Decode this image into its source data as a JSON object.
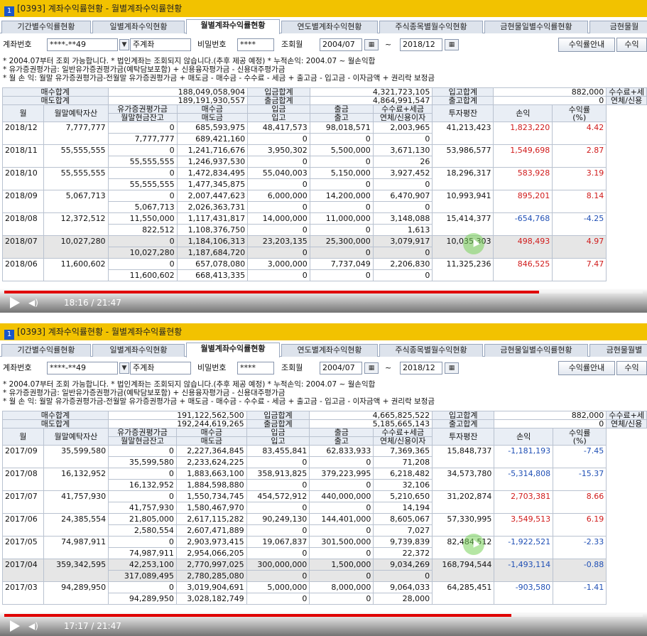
{
  "panels": [
    {
      "window_number": "1",
      "title": "[0393] 계좌수익률현황 - 월별계좌수익률현황",
      "tabs": [
        "기간별수익률현황",
        "일별계좌수익현황",
        "월별계좌수익률현황",
        "연도별계좌수익현황",
        "주식종목별월수익현황",
        "금현물일별수익률현황",
        "금현물월"
      ],
      "active_tab": 2,
      "account_label": "계좌번호",
      "account_value": "****-**49",
      "account_type": "주계좌",
      "password_label": "비밀번호",
      "password_value": "****",
      "period_label": "조회월",
      "from_month": "2004/07",
      "tilde": "~",
      "to_month": "2018/12",
      "btn_guide": "수익률안내",
      "btn_more": "수익",
      "notes": [
        "* 2004.07부터 조회 가능합니다.   * 법인계좌는 조회되지 않습니다.(추후 제공 예정)   * 누적손익: 2004.07 ~ 월손익합",
        "* 유가증권평가금: 일반유가증권평가금(예탁담보포함) + 신용융자평가금 - 신용대주평가금",
        "* 월 손 익: 월말 유가증권평가금-전월말 유가증권평가금 + 매도금 - 매수금 - 수수료 - 세금 + 출고금 - 입고금 - 이자금액 + 권리락 보정금"
      ],
      "summary": {
        "buy_total_label": "매수합계",
        "buy_total": "188,049,058,904",
        "deposit_total_label": "입금합계",
        "deposit_total": "4,321,723,105",
        "in_total_label": "입고합계",
        "in_total": "882,000",
        "fee_tax_label": "수수료+세",
        "sell_total_label": "매도합계",
        "sell_total": "189,191,930,557",
        "withdraw_total_label": "출금합계",
        "withdraw_total": "4,864,991,547",
        "out_total_label": "출고합계",
        "out_total": "0",
        "overdue_label": "연체/신용"
      },
      "headers": {
        "month": "월",
        "end_deposit": "월말예탁자산",
        "sec_eval": "유가증권평가금",
        "end_cash": "월말현금잔고",
        "buy": "매수금",
        "sell": "매도금",
        "deposit": "입금",
        "in": "입고",
        "withdraw": "출금",
        "out": "출고",
        "fee_tax": "수수료+세금",
        "overdue_int": "연체/신용이자",
        "avg_invest": "투자평잔",
        "pl": "손익",
        "rate": "수익률",
        "rate_unit": "(%)"
      },
      "rows": [
        {
          "month": "2018/12",
          "end_deposit": "7,777,777",
          "sec_eval": "0",
          "end_cash": "7,777,777",
          "buy": "685,593,975",
          "sell": "689,421,160",
          "deposit": "48,417,573",
          "in": "0",
          "withdraw": "98,018,571",
          "out": "0",
          "fee_tax": "2,003,965",
          "overdue_int": "0",
          "avg_invest": "41,213,423",
          "pl": "1,823,220",
          "rate": "4.42",
          "sign": "pos"
        },
        {
          "month": "2018/11",
          "end_deposit": "55,555,555",
          "sec_eval": "0",
          "end_cash": "55,555,555",
          "buy": "1,241,716,676",
          "sell": "1,246,937,530",
          "deposit": "3,950,302",
          "in": "0",
          "withdraw": "5,500,000",
          "out": "0",
          "fee_tax": "3,671,130",
          "overdue_int": "26",
          "avg_invest": "53,986,577",
          "pl": "1,549,698",
          "rate": "2.87",
          "sign": "pos"
        },
        {
          "month": "2018/10",
          "end_deposit": "55,555,555",
          "sec_eval": "0",
          "end_cash": "55,555,555",
          "buy": "1,472,834,495",
          "sell": "1,477,345,875",
          "deposit": "55,040,003",
          "in": "0",
          "withdraw": "5,150,000",
          "out": "0",
          "fee_tax": "3,927,452",
          "overdue_int": "0",
          "avg_invest": "18,296,317",
          "pl": "583,928",
          "rate": "3.19",
          "sign": "pos"
        },
        {
          "month": "2018/09",
          "end_deposit": "5,067,713",
          "sec_eval": "0",
          "end_cash": "5,067,713",
          "buy": "2,007,447,623",
          "sell": "2,026,363,731",
          "deposit": "6,000,000",
          "in": "0",
          "withdraw": "14,200,000",
          "out": "0",
          "fee_tax": "6,470,907",
          "overdue_int": "0",
          "avg_invest": "10,993,941",
          "pl": "895,201",
          "rate": "8.14",
          "sign": "pos"
        },
        {
          "month": "2018/08",
          "end_deposit": "12,372,512",
          "sec_eval": "11,550,000",
          "end_cash": "822,512",
          "buy": "1,117,431,817",
          "sell": "1,108,376,750",
          "deposit": "14,000,000",
          "in": "0",
          "withdraw": "11,000,000",
          "out": "0",
          "fee_tax": "3,148,088",
          "overdue_int": "1,613",
          "avg_invest": "15,414,377",
          "pl": "-654,768",
          "rate": "-4.25",
          "sign": "neg"
        },
        {
          "month": "2018/07",
          "end_deposit": "10,027,280",
          "sec_eval": "0",
          "end_cash": "10,027,280",
          "buy": "1,184,106,313",
          "sell": "1,187,684,720",
          "deposit": "23,203,135",
          "in": "0",
          "withdraw": "25,300,000",
          "out": "0",
          "fee_tax": "3,079,917",
          "overdue_int": "0",
          "avg_invest": "10,035,303",
          "pl": "498,493",
          "rate": "4.97",
          "sign": "pos"
        },
        {
          "month": "2018/06",
          "end_deposit": "11,600,602",
          "sec_eval": "0",
          "end_cash": "11,600,602",
          "buy": "657,078,080",
          "sell": "668,413,335",
          "deposit": "3,000,000",
          "in": "0",
          "withdraw": "7,737,049",
          "out": "0",
          "fee_tax": "2,206,830",
          "overdue_int": "0",
          "avg_invest": "11,325,236",
          "pl": "846,525",
          "rate": "7.47",
          "sign": "pos"
        }
      ],
      "highlight_row": 5,
      "cursor_row": 5,
      "video": {
        "time": "18:16 / 21:47",
        "progress": 0.838
      }
    },
    {
      "window_number": "1",
      "title": "[0393] 계좌수익률현황 - 월별계좌수익률현황",
      "tabs": [
        "기간별수익률현황",
        "일별계좌수익현황",
        "월별계좌수익률현황",
        "연도별계좌수익현황",
        "주식종목별월수익현황",
        "금현물일별수익률현황",
        "금현물월별"
      ],
      "active_tab": 2,
      "account_label": "계좌번호",
      "account_value": "****-**49",
      "account_type": "주계좌",
      "password_label": "비밀번호",
      "password_value": "****",
      "period_label": "조회월",
      "from_month": "2004/07",
      "tilde": "~",
      "to_month": "2018/12",
      "btn_guide": "수익률안내",
      "btn_more": "수익",
      "notes": [
        "* 2004.07부터 조회 가능합니다.   * 법인계좌는 조회되지 않습니다.(추후 제공 예정)   * 누적손익: 2004.07 ~ 월손익합",
        "* 유가증권평가금: 일반유가증권평가금(예탁담보포함) + 신용융자평가금 - 신용대주평가금",
        "* 월 손 익: 월말 유가증권평가금-전월말 유가증권평가금 + 매도금 - 매수금 - 수수료 - 세금 + 출고금 - 입고금 - 이자금액 + 권리락 보정금"
      ],
      "summary": {
        "buy_total_label": "매수합계",
        "buy_total": "191,122,562,500",
        "deposit_total_label": "입금합계",
        "deposit_total": "4,665,825,522",
        "in_total_label": "입고합계",
        "in_total": "882,000",
        "fee_tax_label": "수수료+세",
        "sell_total_label": "매도합계",
        "sell_total": "192,244,619,265",
        "withdraw_total_label": "출금합계",
        "withdraw_total": "5,185,665,143",
        "out_total_label": "출고합계",
        "out_total": "0",
        "overdue_label": "연체/신용"
      },
      "headers": {
        "month": "월",
        "end_deposit": "월말예탁자산",
        "sec_eval": "유가증권평가금",
        "end_cash": "월말현금잔고",
        "buy": "매수금",
        "sell": "매도금",
        "deposit": "입금",
        "in": "입고",
        "withdraw": "출금",
        "out": "출고",
        "fee_tax": "수수료+세금",
        "overdue_int": "연체/신용이자",
        "avg_invest": "투자평잔",
        "pl": "손익",
        "rate": "수익률",
        "rate_unit": "(%)"
      },
      "rows": [
        {
          "month": "2017/09",
          "end_deposit": "35,599,580",
          "sec_eval": "0",
          "end_cash": "35,599,580",
          "buy": "2,227,364,845",
          "sell": "2,233,624,225",
          "deposit": "83,455,841",
          "in": "0",
          "withdraw": "62,833,933",
          "out": "0",
          "fee_tax": "7,369,365",
          "overdue_int": "71,208",
          "avg_invest": "15,848,737",
          "pl": "-1,181,193",
          "rate": "-7.45",
          "sign": "neg"
        },
        {
          "month": "2017/08",
          "end_deposit": "16,132,952",
          "sec_eval": "0",
          "end_cash": "16,132,952",
          "buy": "1,883,663,100",
          "sell": "1,884,598,880",
          "deposit": "358,913,825",
          "in": "0",
          "withdraw": "379,223,995",
          "out": "0",
          "fee_tax": "6,218,482",
          "overdue_int": "32,106",
          "avg_invest": "34,573,780",
          "pl": "-5,314,808",
          "rate": "-15.37",
          "sign": "neg"
        },
        {
          "month": "2017/07",
          "end_deposit": "41,757,930",
          "sec_eval": "0",
          "end_cash": "41,757,930",
          "buy": "1,550,734,745",
          "sell": "1,580,467,970",
          "deposit": "454,572,912",
          "in": "0",
          "withdraw": "440,000,000",
          "out": "0",
          "fee_tax": "5,210,650",
          "overdue_int": "14,194",
          "avg_invest": "31,202,874",
          "pl": "2,703,381",
          "rate": "8.66",
          "sign": "pos"
        },
        {
          "month": "2017/06",
          "end_deposit": "24,385,554",
          "sec_eval": "21,805,000",
          "end_cash": "2,580,554",
          "buy": "2,617,115,282",
          "sell": "2,607,471,889",
          "deposit": "90,249,130",
          "in": "0",
          "withdraw": "144,401,000",
          "out": "0",
          "fee_tax": "8,605,067",
          "overdue_int": "7,027",
          "avg_invest": "57,330,995",
          "pl": "3,549,513",
          "rate": "6.19",
          "sign": "pos"
        },
        {
          "month": "2017/05",
          "end_deposit": "74,987,911",
          "sec_eval": "0",
          "end_cash": "74,987,911",
          "buy": "2,903,973,415",
          "sell": "2,954,066,205",
          "deposit": "19,067,837",
          "in": "0",
          "withdraw": "301,500,000",
          "out": "0",
          "fee_tax": "9,739,839",
          "overdue_int": "22,372",
          "avg_invest": "82,484,512",
          "pl": "-1,922,521",
          "rate": "-2.33",
          "sign": "neg"
        },
        {
          "month": "2017/04",
          "end_deposit": "359,342,595",
          "sec_eval": "42,253,100",
          "end_cash": "317,089,495",
          "buy": "2,770,997,025",
          "sell": "2,780,285,080",
          "deposit": "300,000,000",
          "in": "0",
          "withdraw": "1,500,000",
          "out": "0",
          "fee_tax": "9,034,269",
          "overdue_int": "0",
          "avg_invest": "168,794,544",
          "pl": "-1,493,114",
          "rate": "-0.88",
          "sign": "neg"
        },
        {
          "month": "2017/03",
          "end_deposit": "94,289,950",
          "sec_eval": "0",
          "end_cash": "94,289,950",
          "buy": "3,019,904,691",
          "sell": "3,028,182,749",
          "deposit": "5,000,000",
          "in": "0",
          "withdraw": "8,000,000",
          "out": "0",
          "fee_tax": "9,064,033",
          "overdue_int": "28,000",
          "avg_invest": "64,285,451",
          "pl": "-903,580",
          "rate": "-1.41",
          "sign": "neg"
        }
      ],
      "highlight_row": 5,
      "cursor_row": 4,
      "video": {
        "time": "17:17 / 21:47",
        "progress": 0.794
      }
    }
  ]
}
